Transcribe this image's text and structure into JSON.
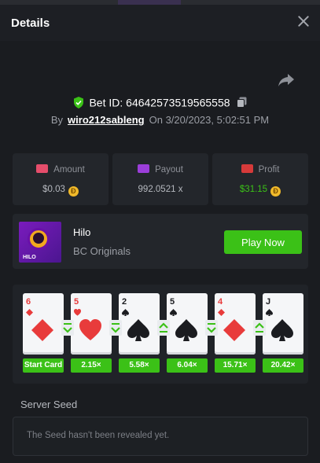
{
  "header": {
    "title": "Details"
  },
  "bet": {
    "id_label": "Bet ID: 64642573519565558",
    "by_label": "By",
    "user": "wiro212sableng",
    "on_label": "On",
    "date": "3/20/2023, 5:02:51 PM"
  },
  "stats": {
    "amount": {
      "label": "Amount",
      "value": "$0.03",
      "icon": "wallet-coins-icon"
    },
    "payout": {
      "label": "Payout",
      "value": "992.0521 x",
      "icon": "card-icon"
    },
    "profit": {
      "label": "Profit",
      "value": "$31.15",
      "icon": "money-hand-icon"
    }
  },
  "game": {
    "name": "Hilo",
    "provider": "BC Originals",
    "thumb_tag": "HILO",
    "play_label": "Play Now"
  },
  "cards": [
    {
      "rank": "6",
      "suit": "diamond",
      "color": "red",
      "multiplier": "Start Card"
    },
    {
      "rank": "5",
      "suit": "heart",
      "color": "red",
      "multiplier": "2.15×",
      "arrow": "down"
    },
    {
      "rank": "2",
      "suit": "spade",
      "color": "black",
      "multiplier": "5.58×",
      "arrow": "down"
    },
    {
      "rank": "5",
      "suit": "spade",
      "color": "black",
      "multiplier": "6.04×",
      "arrow": "up"
    },
    {
      "rank": "4",
      "suit": "diamond",
      "color": "red",
      "multiplier": "15.71×",
      "arrow": "down"
    },
    {
      "rank": "J",
      "suit": "spade",
      "color": "black",
      "multiplier": "20.42×",
      "arrow": "up"
    }
  ],
  "seed": {
    "label": "Server Seed",
    "text": "The Seed hasn't been revealed yet."
  },
  "colors": {
    "accent": "#3bc117",
    "background": "#1a1c20",
    "coin": "#f0b92a"
  }
}
